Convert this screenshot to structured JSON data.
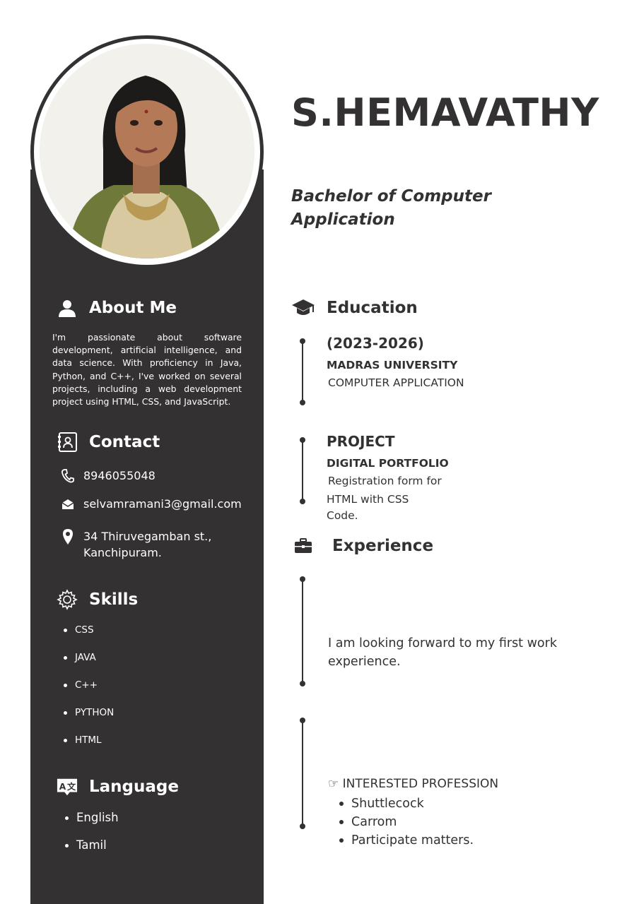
{
  "header": {
    "name": "S.HEMAVATHY",
    "degree": "Bachelor of Computer Application"
  },
  "about": {
    "title": "About Me",
    "icon": "user-icon",
    "text": "I'm passionate about software development, artificial intelligence, and data science. With proficiency in Java, Python, and C++, I've worked on several projects, including a web development project using HTML, CSS, and JavaScript."
  },
  "contact": {
    "title": "Contact",
    "icon": "contact-book-icon",
    "phone": "8946055048",
    "email": "selvamramani3@gmail.com",
    "address_line1": "34 Thiruvegamban st.,",
    "address_line2": "Kanchipuram."
  },
  "skills": {
    "title": "Skills",
    "icon": "gear-icon",
    "items": [
      "CSS",
      "JAVA",
      "C++",
      "PYTHON",
      "HTML"
    ]
  },
  "language": {
    "title": "Language",
    "icon": "translate-icon",
    "items": [
      "English",
      "Tamil"
    ]
  },
  "education": {
    "title": "Education",
    "icon": "graduation-cap-icon",
    "years": "(2023-2026)",
    "institution": "MADRAS UNIVERSITY",
    "course": "COMPUTER APPLICATION"
  },
  "project": {
    "title": "PROJECT",
    "name": "DIGITAL PORTFOLIO",
    "line1": "Registration form for",
    "line2": "HTML with CSS",
    "line3": "Code."
  },
  "experience": {
    "title": "Experience",
    "icon": "briefcase-icon",
    "text": "I am looking forward to my first work experience."
  },
  "interests": {
    "title": "☞ INTERESTED PROFESSION",
    "items": [
      "Shuttlecock",
      "Carrom",
      "Participate matters."
    ]
  },
  "colors": {
    "sidebar": "#333132",
    "text": "#333132",
    "background": "#ffffff"
  }
}
